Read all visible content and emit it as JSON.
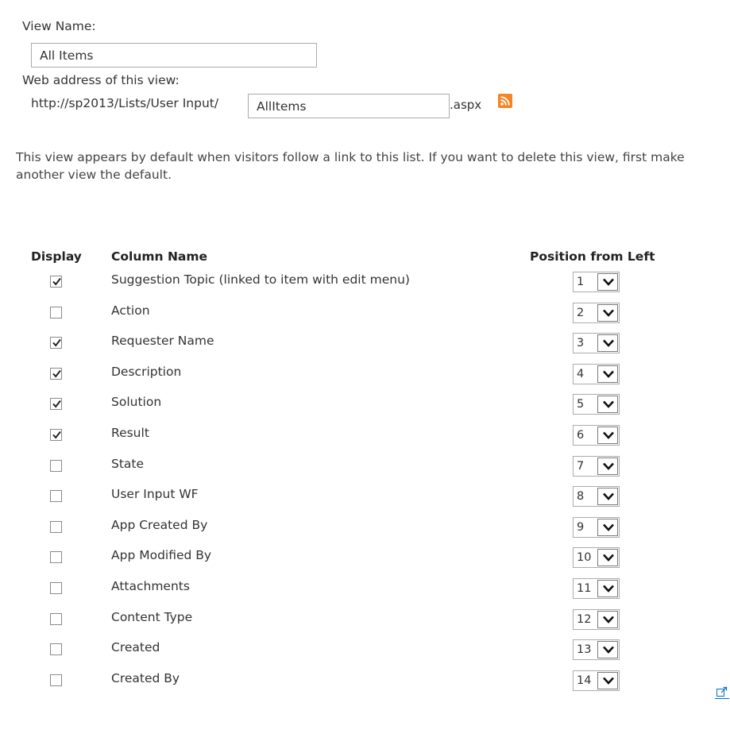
{
  "view_name": {
    "label": "View Name:",
    "value": "All Items"
  },
  "web_address": {
    "label": "Web address of this view:",
    "prefix": "http://sp2013/Lists/User Input/",
    "value": "AllItems",
    "suffix": ".aspx",
    "rss_icon": "rss-feed-icon"
  },
  "description": "This view appears by default when visitors follow a link to this list. If you want to delete this view, first make another view the default.",
  "columns_table": {
    "headers": {
      "display": "Display",
      "column_name": "Column Name",
      "position": "Position from Left"
    },
    "rows": [
      {
        "name": "Suggestion Topic (linked to item with edit menu)",
        "checked": true,
        "position": "1"
      },
      {
        "name": "Action",
        "checked": false,
        "position": "2"
      },
      {
        "name": "Requester Name",
        "checked": true,
        "position": "3"
      },
      {
        "name": "Description",
        "checked": true,
        "position": "4"
      },
      {
        "name": "Solution",
        "checked": true,
        "position": "5"
      },
      {
        "name": "Result",
        "checked": true,
        "position": "6"
      },
      {
        "name": "State",
        "checked": false,
        "position": "7"
      },
      {
        "name": "User Input WF",
        "checked": false,
        "position": "8"
      },
      {
        "name": "App Created By",
        "checked": false,
        "position": "9"
      },
      {
        "name": "App Modified By",
        "checked": false,
        "position": "10"
      },
      {
        "name": "Attachments",
        "checked": false,
        "position": "11"
      },
      {
        "name": "Content Type",
        "checked": false,
        "position": "12"
      },
      {
        "name": "Created",
        "checked": false,
        "position": "13"
      },
      {
        "name": "Created By",
        "checked": false,
        "position": "14"
      },
      {
        "name": "",
        "checked": false,
        "position": ""
      }
    ]
  },
  "icons": {
    "checkbox_tick": "check-icon",
    "dropdown": "chevron-down-icon",
    "external": "open-in-new-window-icon"
  },
  "colors": {
    "rss": "#f78422",
    "link_blue": "#0072c6",
    "border": "#ababab"
  }
}
